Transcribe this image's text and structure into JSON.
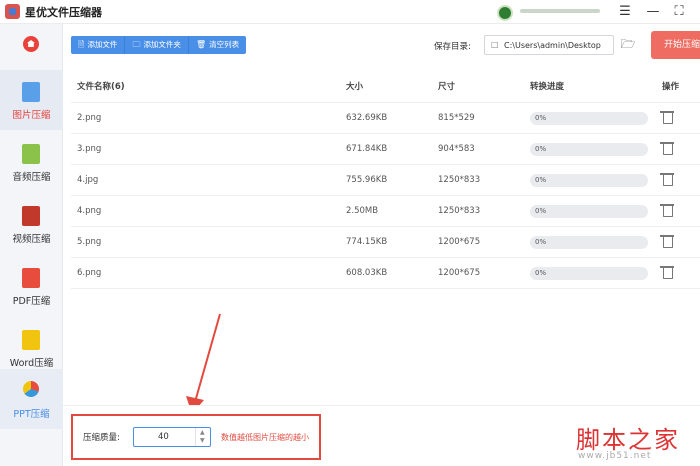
{
  "app": {
    "title": "星优文件压缩器"
  },
  "window": {
    "menu_icon": "hamburger-icon",
    "minimize_icon": "minimize-icon",
    "maximize_icon": "maximize-icon"
  },
  "sidebar": {
    "home_icon": "home-icon",
    "items": [
      {
        "label": "图片压缩",
        "icon": "image-icon",
        "active": true
      },
      {
        "label": "音频压缩",
        "icon": "music-icon",
        "active": false
      },
      {
        "label": "视频压缩",
        "icon": "video-icon",
        "active": false
      },
      {
        "label": "PDF压缩",
        "icon": "pdf-icon",
        "active": false
      },
      {
        "label": "Word压缩",
        "icon": "word-icon",
        "active": false
      },
      {
        "label": "PPT压缩",
        "icon": "ppt-icon",
        "active": false
      }
    ]
  },
  "toolbar": {
    "add_file": "添加文件",
    "add_folder": "添加文件夹",
    "clear_list": "清空列表",
    "save_dir_label": "保存目录:",
    "save_path": "C:\\Users\\admin\\Desktop",
    "start_button": "开始压缩"
  },
  "table": {
    "headers": {
      "name": "文件名称(6)",
      "size": "大小",
      "dimension": "尺寸",
      "progress": "转换进度",
      "action": "操作"
    },
    "rows": [
      {
        "name": "2.png",
        "size": "632.69KB",
        "dimension": "815*529",
        "progress": "0%"
      },
      {
        "name": "3.png",
        "size": "671.84KB",
        "dimension": "904*583",
        "progress": "0%"
      },
      {
        "name": "4.jpg",
        "size": "755.96KB",
        "dimension": "1250*833",
        "progress": "0%"
      },
      {
        "name": "4.png",
        "size": "2.50MB",
        "dimension": "1250*833",
        "progress": "0%"
      },
      {
        "name": "5.png",
        "size": "774.15KB",
        "dimension": "1200*675",
        "progress": "0%"
      },
      {
        "name": "6.png",
        "size": "608.03KB",
        "dimension": "1200*675",
        "progress": "0%"
      }
    ]
  },
  "bottom": {
    "quality_label": "压缩质量:",
    "quality_value": "40",
    "quality_hint": "数值越低图片压缩的越小"
  },
  "watermark": {
    "text": "脚本之家",
    "url": "www.jb51.net"
  },
  "colors": {
    "accent": "#4a8fe7",
    "start_button": "#ee6c62",
    "highlight": "#e24a3f",
    "active_nav": "#e8433b"
  }
}
